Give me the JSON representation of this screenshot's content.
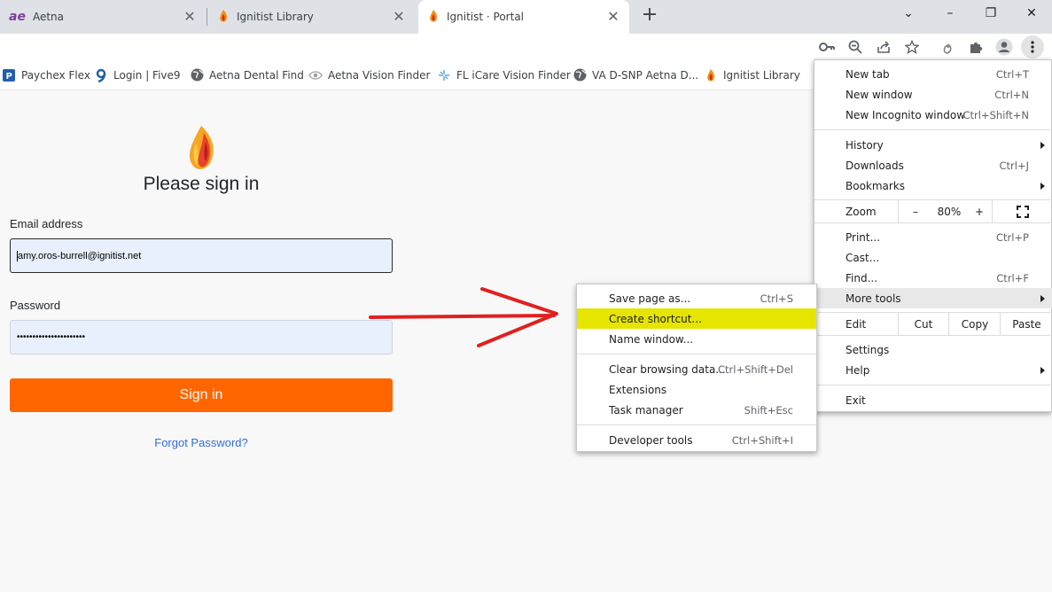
{
  "tabs": [
    {
      "title": "Aetna",
      "icon": "aetna-logo",
      "active": false
    },
    {
      "title": "Ignitist Library",
      "icon": "flame-icon",
      "active": false
    },
    {
      "title": "Ignitist · Portal",
      "icon": "flame-icon",
      "active": true
    }
  ],
  "tab_close_glyph": "✕",
  "new_tab_glyph": "+",
  "window_controls": {
    "dropdown": "⌄",
    "minimize": "–",
    "restore": "❐",
    "close": "✕"
  },
  "toolbar_icons": [
    "key-icon",
    "zoom-icon",
    "share-icon",
    "star-icon",
    "extension-flame-icon",
    "puzzle-icon",
    "profile-icon",
    "kebab-menu-icon"
  ],
  "bookmarks": [
    {
      "label": "Paychex Flex",
      "icon": "paychex-icon"
    },
    {
      "label": "Login | Five9",
      "icon": "five9-icon"
    },
    {
      "label": "Aetna Dental Find",
      "icon": "globe-icon"
    },
    {
      "label": "Aetna Vision Finder",
      "icon": "eye-icon"
    },
    {
      "label": "FL iCare Vision Finder",
      "icon": "sparkle-icon"
    },
    {
      "label": "VA D-SNP Aetna D...",
      "icon": "globe-icon"
    },
    {
      "label": "Ignitist Library",
      "icon": "flame-icon"
    }
  ],
  "login": {
    "title": "Please sign in",
    "email_label": "Email address",
    "email_value": "amy.oros-burrell@ignitist.net",
    "password_label": "Password",
    "password_mask": "••••••••••••••••••••••",
    "signin_button": "Sign in",
    "forgot_link": "Forgot Password?"
  },
  "main_menu": {
    "new_tab": {
      "label": "New tab",
      "shortcut": "Ctrl+T"
    },
    "new_window": {
      "label": "New window",
      "shortcut": "Ctrl+N"
    },
    "new_incognito": {
      "label": "New Incognito window",
      "shortcut": "Ctrl+Shift+N"
    },
    "history": {
      "label": "History"
    },
    "downloads": {
      "label": "Downloads",
      "shortcut": "Ctrl+J"
    },
    "bookmarks": {
      "label": "Bookmarks"
    },
    "zoom": {
      "label": "Zoom",
      "minus": "–",
      "value": "80%",
      "plus": "+"
    },
    "print": {
      "label": "Print...",
      "shortcut": "Ctrl+P"
    },
    "cast": {
      "label": "Cast..."
    },
    "find": {
      "label": "Find...",
      "shortcut": "Ctrl+F"
    },
    "more_tools": {
      "label": "More tools"
    },
    "edit": {
      "label": "Edit",
      "cut": "Cut",
      "copy": "Copy",
      "paste": "Paste"
    },
    "settings": {
      "label": "Settings"
    },
    "help": {
      "label": "Help"
    },
    "exit": {
      "label": "Exit"
    }
  },
  "more_tools_menu": {
    "save_page": {
      "label": "Save page as...",
      "shortcut": "Ctrl+S"
    },
    "create_shortcut": {
      "label": "Create shortcut..."
    },
    "name_window": {
      "label": "Name window..."
    },
    "clear_browsing": {
      "label": "Clear browsing data...",
      "shortcut": "Ctrl+Shift+Del"
    },
    "extensions": {
      "label": "Extensions"
    },
    "task_manager": {
      "label": "Task manager",
      "shortcut": "Shift+Esc"
    },
    "developer_tools": {
      "label": "Developer tools",
      "shortcut": "Ctrl+Shift+I"
    }
  },
  "colors": {
    "signin_button": "#ff6600",
    "highlight": "#e5e500",
    "arrow": "#e02020",
    "link": "#2f6ed8"
  }
}
